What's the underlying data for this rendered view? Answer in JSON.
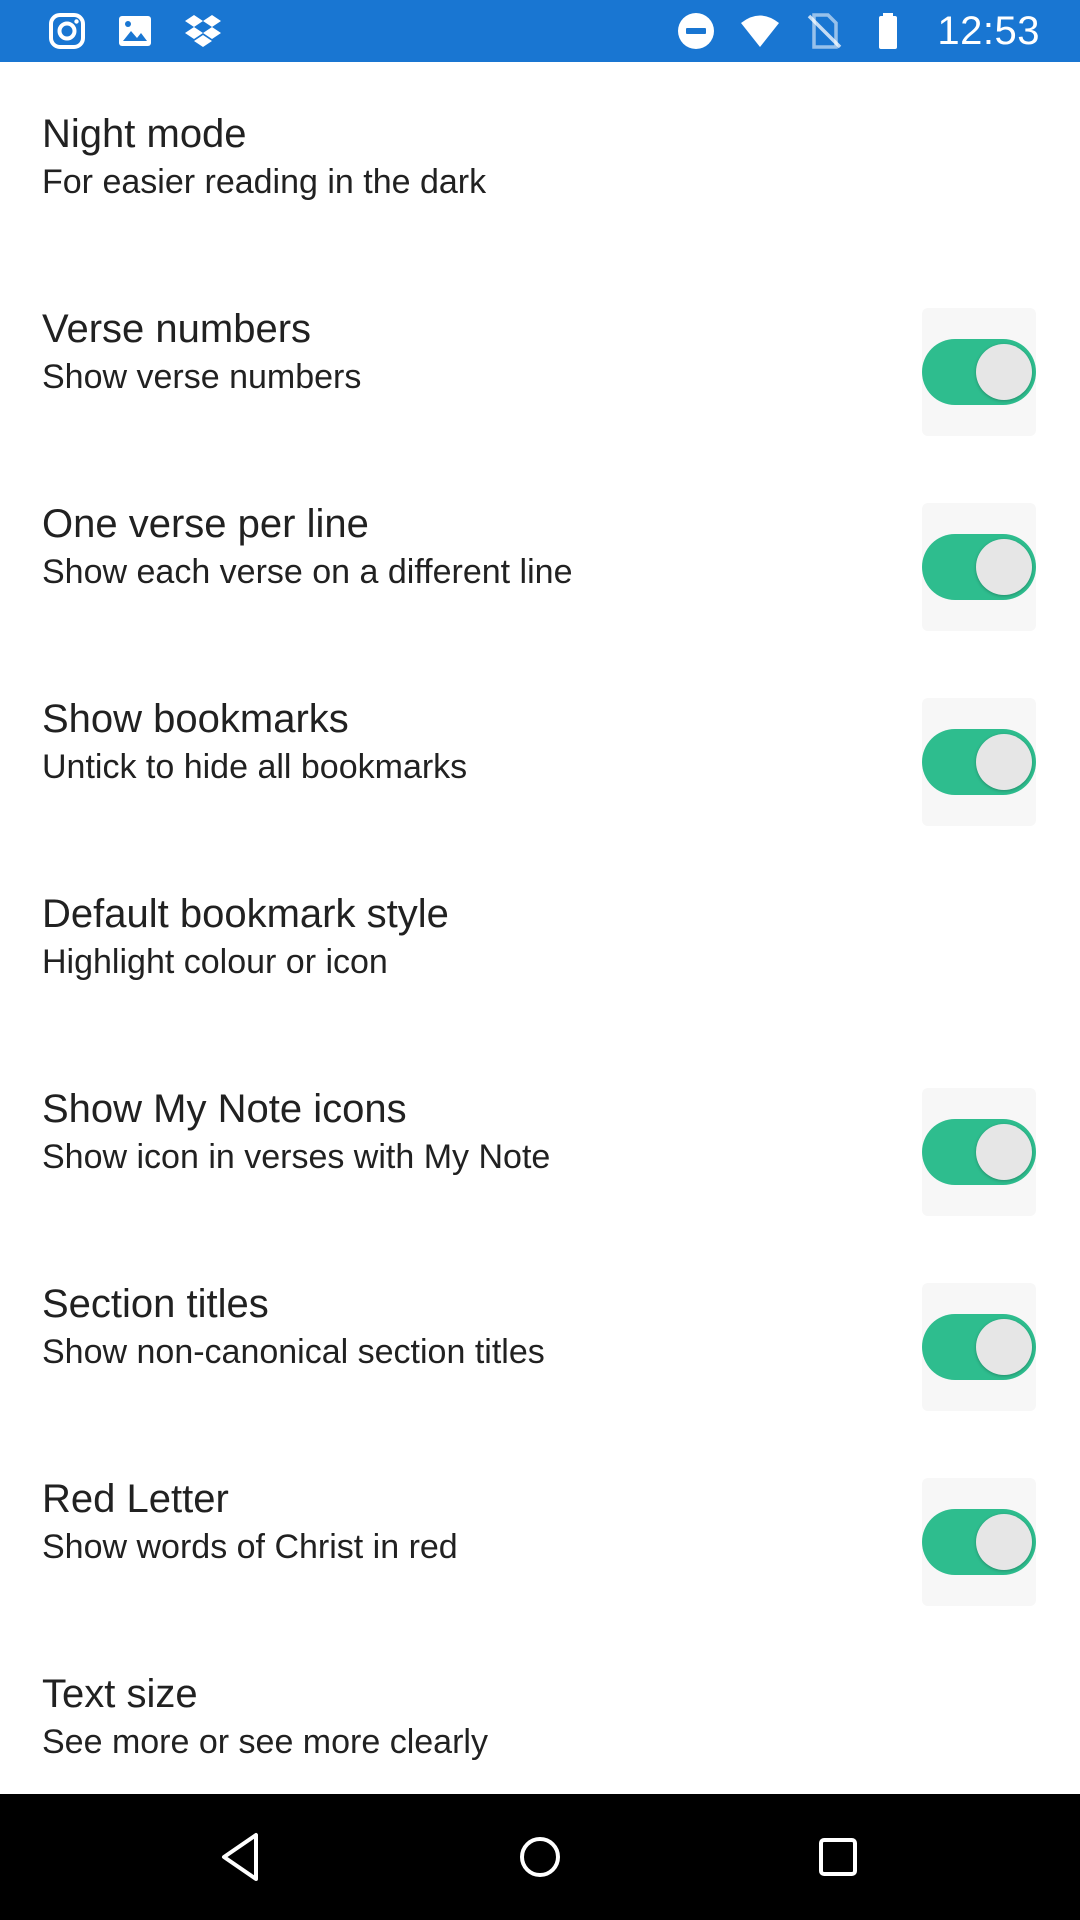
{
  "status_bar": {
    "left_icons": [
      "instagram-icon",
      "image-icon",
      "dropbox-icon"
    ],
    "right_icons": [
      "do-not-disturb-icon",
      "wifi-icon",
      "no-sim-icon",
      "battery-icon"
    ],
    "time": "12:53",
    "background_color": "#1976d2"
  },
  "preferences": [
    {
      "title": "Night mode",
      "summary": "For easier reading in the dark",
      "has_switch": false
    },
    {
      "title": "Verse numbers",
      "summary": "Show verse numbers",
      "has_switch": true,
      "checked": true
    },
    {
      "title": "One verse per line",
      "summary": "Show each verse on a different line",
      "has_switch": true,
      "checked": true
    },
    {
      "title": "Show bookmarks",
      "summary": "Untick to hide all bookmarks",
      "has_switch": true,
      "checked": true
    },
    {
      "title": "Default bookmark style",
      "summary": "Highlight colour or icon",
      "has_switch": false
    },
    {
      "title": "Show My Note icons",
      "summary": "Show icon in verses with My Note",
      "has_switch": true,
      "checked": true
    },
    {
      "title": "Section titles",
      "summary": "Show non-canonical section titles",
      "has_switch": true,
      "checked": true
    },
    {
      "title": "Red Letter",
      "summary": "Show words of Christ in red",
      "has_switch": true,
      "checked": true
    },
    {
      "title": "Text size",
      "summary": "See more or see more clearly",
      "has_switch": false
    }
  ],
  "switch_on_color": "#2ebd8e",
  "nav_bar": {
    "buttons": [
      "back-icon",
      "home-icon",
      "recents-icon"
    ]
  }
}
